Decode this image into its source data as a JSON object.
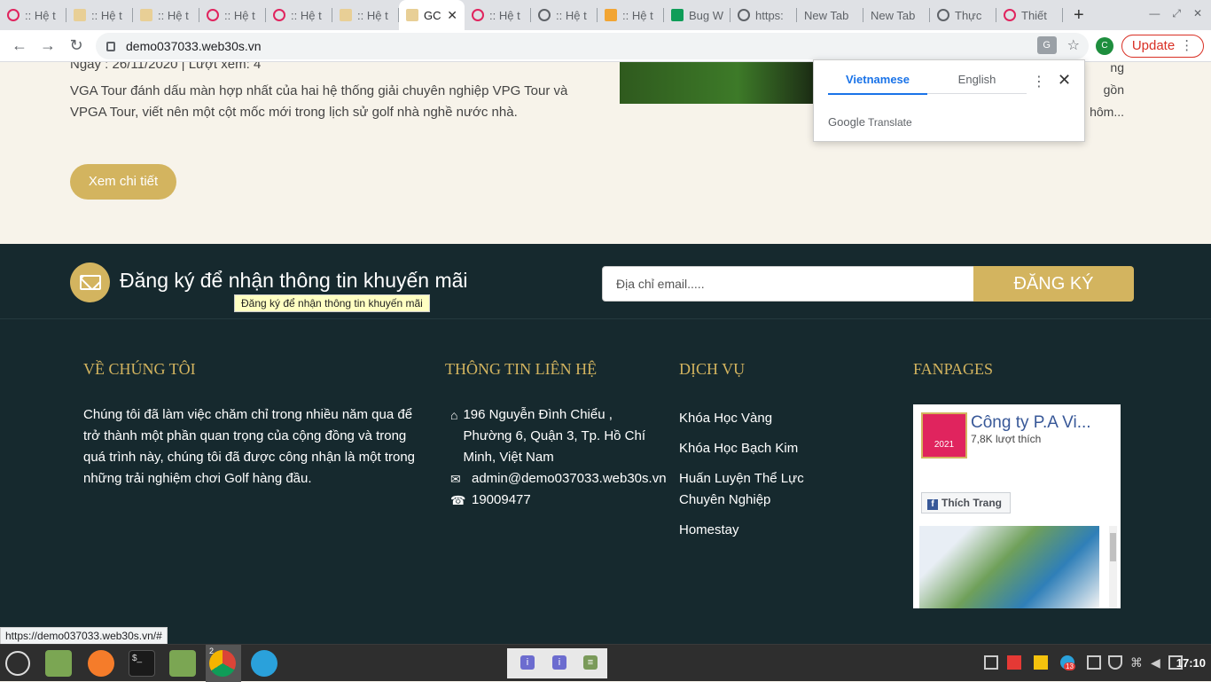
{
  "tabs": [
    {
      "label": ":: Hệ t",
      "favicon": "red-circle-icon"
    },
    {
      "label": ":: Hệ t",
      "favicon": "gold-logo-icon"
    },
    {
      "label": ":: Hệ t",
      "favicon": "gold-logo-icon"
    },
    {
      "label": ":: Hệ t",
      "favicon": "red-circle-icon"
    },
    {
      "label": ":: Hệ t",
      "favicon": "red-circle-icon"
    },
    {
      "label": ":: Hệ t",
      "favicon": "gold-logo-icon"
    },
    {
      "label": "GC",
      "favicon": "gold-logo-icon",
      "active": true
    },
    {
      "label": ":: Hệ t",
      "favicon": "red-circle-icon"
    },
    {
      "label": ":: Hệ t",
      "favicon": "globe-icon"
    },
    {
      "label": ":: Hệ t",
      "favicon": "orange-logo-icon"
    },
    {
      "label": "Bug W",
      "favicon": "green-sheet-icon"
    },
    {
      "label": "https:",
      "favicon": "globe-icon"
    },
    {
      "label": "New Tab",
      "favicon": ""
    },
    {
      "label": "New Tab",
      "favicon": ""
    },
    {
      "label": "Thực",
      "favicon": "globe-icon"
    },
    {
      "label": "Thiết",
      "favicon": "red-circle-icon"
    }
  ],
  "toolbar": {
    "url": "demo037033.web30s.vn",
    "avatar_letter": "C",
    "update_label": "Update"
  },
  "news": {
    "meta": "Ngày : 26/11/2020 | Lượt xem:  4",
    "text": "VGA Tour đánh dấu màn hợp nhất của hai hệ thống giải chuyên nghiệp VPG Tour và VPGA Tour, viết nên một cột mốc mới trong lịch sử golf nhà nghề nước nhà.",
    "right_line1": "ng gồn",
    "right_line2": "hôm...",
    "more_label": "Xem chi tiết"
  },
  "newsletter": {
    "title": "Đăng ký để nhận thông tin khuyến mãi",
    "tooltip": "Đăng ký để nhận thông tin khuyến mãi",
    "placeholder": "Địa chỉ email.....",
    "submit_label": "ĐĂNG KÝ"
  },
  "footer": {
    "about_title": "VỀ CHÚNG TÔI",
    "about_text": "Chúng tôi đã làm việc chăm chỉ trong nhiều năm qua để trở thành một phần quan trọng của cộng đồng và trong quá trình này, chúng tôi đã được công nhận là một trong những trải nghiệm chơi Golf hàng đầu.",
    "contact_title": "THÔNG TIN LIÊN HỆ",
    "address": "196 Nguyễn Đình Chiểu , Phường 6, Quận 3, Tp. Hồ Chí Minh, Việt Nam",
    "email": "admin@demo037033.web30s.vn",
    "phone": "19009477",
    "services_title": "DỊCH VỤ",
    "services": [
      "Khóa Học Vàng",
      "Khóa Học Bạch Kim",
      "Huấn Luyện Thể Lực Chuyên Nghiệp",
      "Homestay"
    ],
    "fanpage_title": "FANPAGES",
    "fanpage_name": "Công ty P.A Vi...",
    "fanpage_likes": "7,8K lượt thích",
    "fanpage_like_btn": "Thích Trang"
  },
  "status_url": "https://demo037033.web30s.vn/#",
  "translate_popup": {
    "lang_selected": "Vietnamese",
    "lang_other": "English",
    "brand_google": "Google",
    "brand_translate": "Translate"
  },
  "taskbar": {
    "clock": "17:10",
    "chrome_count": "2",
    "badge": "13"
  },
  "colors": {
    "accent_gold": "#d3b45f",
    "footer_bg": "#16292e",
    "page_bg": "#f7f3ea"
  }
}
